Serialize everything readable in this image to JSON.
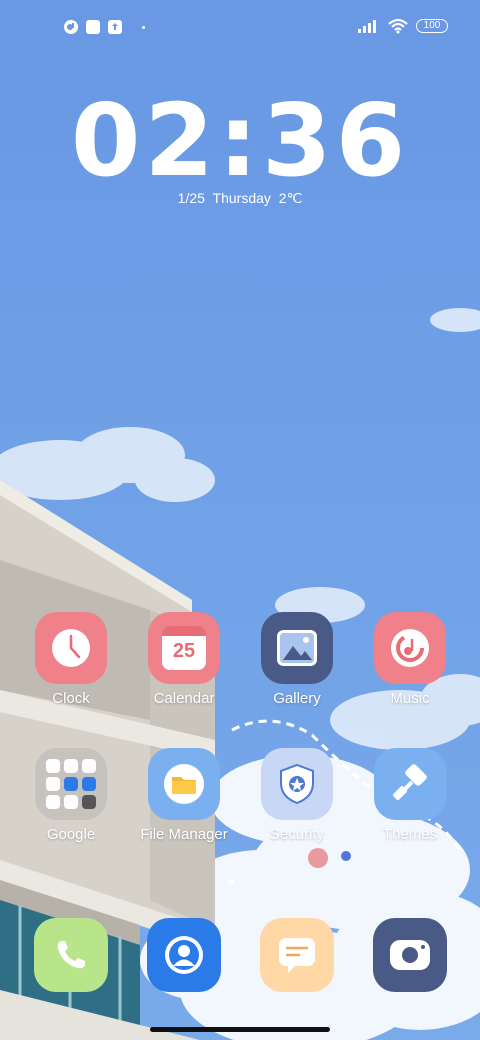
{
  "status_bar": {
    "battery": "100",
    "icons": [
      "notification-app-icon",
      "square-icon",
      "upload-icon",
      "dot-icon",
      "signal-icon",
      "wifi-icon",
      "battery-icon"
    ]
  },
  "lock_clock": {
    "time": "02:36",
    "date": "1/25  Thursday  2℃"
  },
  "apps": [
    {
      "label": "Clock",
      "icon": "clock-icon",
      "color": "#f0808a"
    },
    {
      "label": "Calendar",
      "icon": "calendar-icon",
      "color": "#f0808a",
      "badge": "25"
    },
    {
      "label": "Gallery",
      "icon": "gallery-icon",
      "color": "#4a5a86"
    },
    {
      "label": "Music",
      "icon": "music-icon",
      "color": "#f0808a"
    },
    {
      "label": "Google",
      "icon": "folder-icon",
      "color": "#b4b2b0"
    },
    {
      "label": "File Manager",
      "icon": "folder-manager-icon",
      "color": "#7bb0f0"
    },
    {
      "label": "Security",
      "icon": "shield-icon",
      "color": "#c9d7f7"
    },
    {
      "label": "Themes",
      "icon": "brush-icon",
      "color": "#7bb0f0"
    }
  ],
  "dock": [
    {
      "name": "phone",
      "icon": "phone-icon",
      "color": "#b9e58a"
    },
    {
      "name": "contacts",
      "icon": "contacts-icon",
      "color": "#2a7be8"
    },
    {
      "name": "messages",
      "icon": "message-icon",
      "color": "#ffd8a6"
    },
    {
      "name": "camera",
      "icon": "camera-icon",
      "color": "#4a5a86"
    }
  ],
  "colors": {
    "sky": "#6c9ee6",
    "building": "#d9d4cc"
  }
}
